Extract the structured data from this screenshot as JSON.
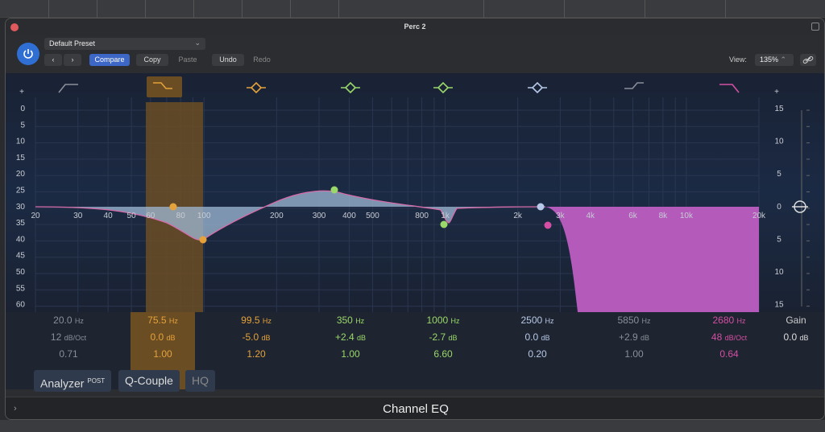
{
  "window": {
    "title": "Perc 2"
  },
  "header": {
    "preset": "Default Preset",
    "compare": "Compare",
    "copy": "Copy",
    "paste": "Paste",
    "undo": "Undo",
    "redo": "Redo",
    "view_label": "View:",
    "view_value": "135%"
  },
  "graph": {
    "plus_left": "+",
    "plus_right": "+",
    "db_scale_left": [
      "0",
      "5",
      "10",
      "15",
      "20",
      "25",
      "30",
      "35",
      "40",
      "45",
      "50",
      "55",
      "60"
    ],
    "gain_scale_right": [
      "15",
      "10",
      "5",
      "0",
      "5",
      "10",
      "15"
    ],
    "freq_labels": [
      "20",
      "30",
      "40",
      "50",
      "60",
      "80",
      "100",
      "200",
      "300",
      "400",
      "500",
      "800",
      "1k",
      "2k",
      "3k",
      "4k",
      "6k",
      "8k",
      "10k",
      "20k"
    ]
  },
  "bands": [
    {
      "freq": "20.0",
      "freq_unit": "Hz",
      "p2": "12",
      "p2_unit": "dB/Oct",
      "q": "0.71",
      "color": "#8a8f99",
      "type": "low-cut"
    },
    {
      "freq": "75.5",
      "freq_unit": "Hz",
      "p2": "0.0",
      "p2_unit": "dB",
      "q": "1.00",
      "color": "#e5a23a",
      "type": "low-shelf"
    },
    {
      "freq": "99.5",
      "freq_unit": "Hz",
      "p2": "-5.0",
      "p2_unit": "dB",
      "q": "1.20",
      "color": "#e5a23a",
      "type": "bell"
    },
    {
      "freq": "350",
      "freq_unit": "Hz",
      "p2": "+2.4",
      "p2_unit": "dB",
      "q": "1.00",
      "color": "#9ad86a",
      "type": "bell"
    },
    {
      "freq": "1000",
      "freq_unit": "Hz",
      "p2": "-2.7",
      "p2_unit": "dB",
      "q": "6.60",
      "color": "#9ad86a",
      "type": "bell"
    },
    {
      "freq": "2500",
      "freq_unit": "Hz",
      "p2": "0.0",
      "p2_unit": "dB",
      "q": "0.20",
      "color": "#b7c9e8",
      "type": "bell"
    },
    {
      "freq": "5850",
      "freq_unit": "Hz",
      "p2": "+2.9",
      "p2_unit": "dB",
      "q": "1.00",
      "color": "#8a8f99",
      "type": "high-shelf"
    },
    {
      "freq": "2680",
      "freq_unit": "Hz",
      "p2": "48",
      "p2_unit": "dB/Oct",
      "q": "0.64",
      "color": "#d44fa3",
      "type": "high-cut"
    }
  ],
  "gain": {
    "label": "Gain",
    "value": "0.0",
    "unit": "dB"
  },
  "buttons": {
    "analyzer": "Analyzer",
    "analyzer_sup": "POST",
    "qcouple": "Q-Couple",
    "hq": "HQ"
  },
  "footer": {
    "name": "Channel EQ"
  }
}
